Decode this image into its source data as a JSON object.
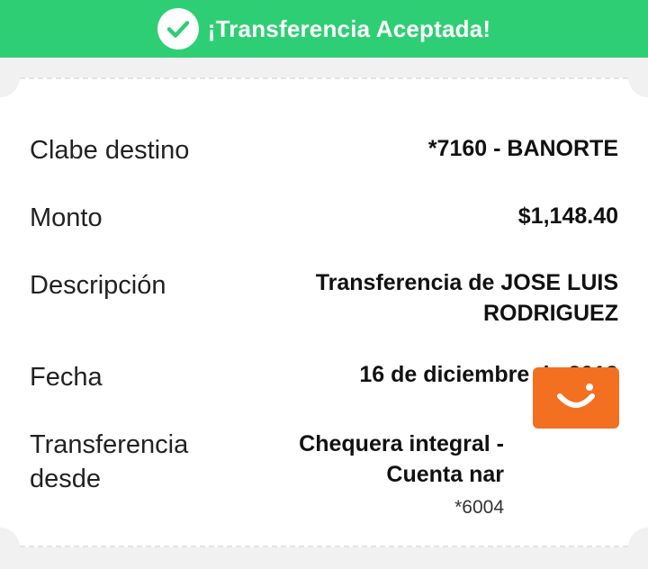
{
  "banner": {
    "title": "¡Transferencia Aceptada!",
    "icon": "check-circle-icon",
    "color": "#2ecf74"
  },
  "details": {
    "clabe": {
      "label": "Clabe destino",
      "value": "*7160 - BANORTE"
    },
    "monto": {
      "label": "Monto",
      "value": "$1,148.40"
    },
    "descripcion": {
      "label": "Descripción",
      "value_line1": "Transferencia de JOSE LUIS",
      "value_line2": "RODRIGUEZ"
    },
    "fecha": {
      "label": "Fecha",
      "value": "16 de diciembre de 2019"
    },
    "origen": {
      "label_line1": "Transferencia",
      "label_line2": "desde",
      "account_line1": "Chequera integral -",
      "account_line2": "Cuenta nar",
      "account_number": "*6004",
      "bank_logo_icon": "smile-logo-icon",
      "bank_logo_color": "#f37021"
    }
  }
}
